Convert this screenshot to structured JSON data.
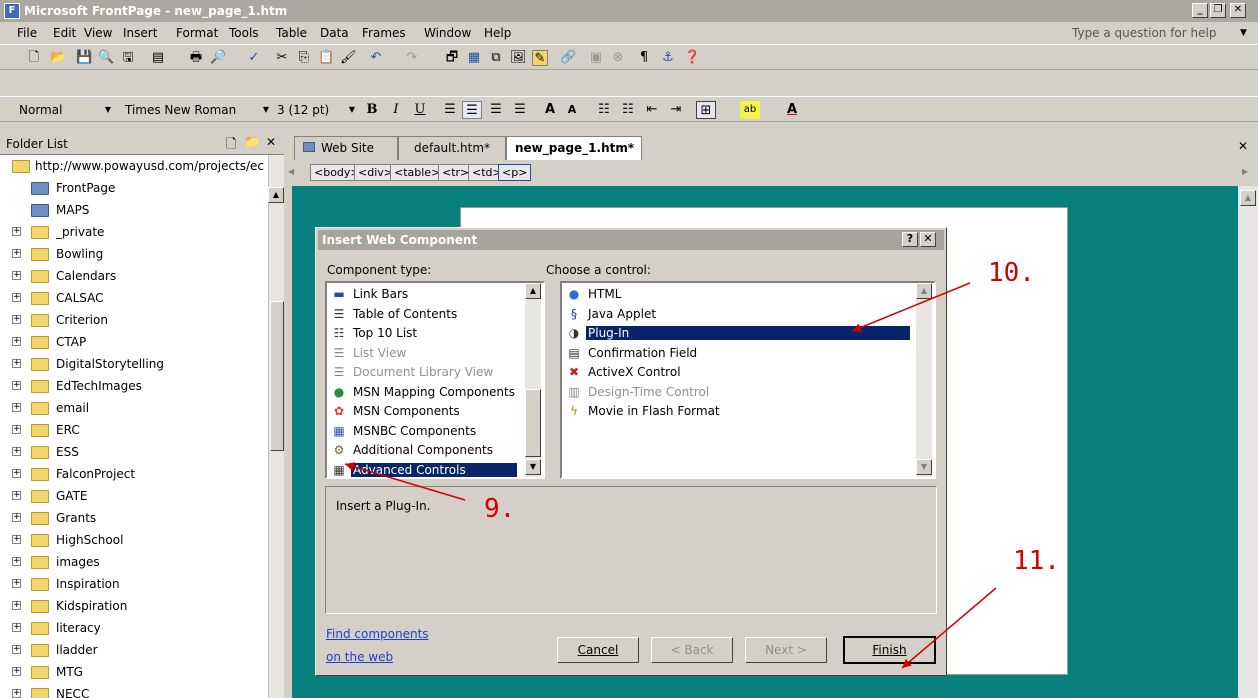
{
  "window": {
    "title": "Microsoft FrontPage - new_page_1.htm",
    "min": "_",
    "max": "❐",
    "close": "✕"
  },
  "menu": {
    "items": [
      "File",
      "Edit",
      "View",
      "Insert",
      "Format",
      "Tools",
      "Table",
      "Data",
      "Frames",
      "Window",
      "Help"
    ],
    "help_placeholder": "Type a question for help"
  },
  "format_toolbar": {
    "style": "Normal",
    "font": "Times New Roman",
    "size": "3 (12 pt)",
    "bold": "B",
    "italic": "I",
    "underline": "U"
  },
  "folder_list": {
    "title": "Folder List",
    "root": "http://www.powayusd.com/projects/ec",
    "special": [
      "FrontPage",
      "MAPS"
    ],
    "folders": [
      "_private",
      "Bowling",
      "Calendars",
      "CALSAC",
      "Criterion",
      "CTAP",
      "DigitalStorytelling",
      "EdTechImages",
      "email",
      "ERC",
      "ESS",
      "FalconProject",
      "GATE",
      "Grants",
      "HighSchool",
      "images",
      "Inspiration",
      "Kidspiration",
      "literacy",
      "lladder",
      "MTG",
      "NECC"
    ]
  },
  "tabs": [
    "Web Site",
    "default.htm*",
    "new_page_1.htm*"
  ],
  "tags": [
    "<body>",
    "<div>",
    "<table>",
    "<tr>",
    "<td>",
    "<p>"
  ],
  "dialog": {
    "title": "Insert Web Component",
    "help": "?",
    "close": "✕",
    "component_label": "Component type:",
    "control_label": "Choose a control:",
    "components": [
      {
        "label": "Link Bars",
        "icon": "link-bars-icon",
        "glyph": "▬",
        "color": "#1f4fa3"
      },
      {
        "label": "Table of Contents",
        "icon": "toc-icon",
        "glyph": "☰",
        "color": "#333"
      },
      {
        "label": "Top 10 List",
        "icon": "top10-icon",
        "glyph": "☷",
        "color": "#333"
      },
      {
        "label": "List View",
        "icon": "list-view-icon",
        "glyph": "☰",
        "color": "#888",
        "disabled": true
      },
      {
        "label": "Document Library View",
        "icon": "doc-library-icon",
        "glyph": "☰",
        "color": "#888",
        "disabled": true
      },
      {
        "label": "MSN Mapping Components",
        "icon": "globe-icon",
        "glyph": "●",
        "color": "#2a8f3a"
      },
      {
        "label": "MSN Components",
        "icon": "msn-butterfly-icon",
        "glyph": "✿",
        "color": "#e23a2a"
      },
      {
        "label": "MSNBC Components",
        "icon": "msnbc-icon",
        "glyph": "▦",
        "color": "#3050c0"
      },
      {
        "label": "Additional Components",
        "icon": "gear-icon",
        "glyph": "⚙",
        "color": "#6b6b20"
      },
      {
        "label": "Advanced Controls",
        "icon": "advanced-controls-icon",
        "glyph": "▦",
        "color": "#333",
        "selected": true
      }
    ],
    "controls": [
      {
        "label": "HTML",
        "icon": "html-globe-icon",
        "glyph": "●",
        "color": "#2b6fd0"
      },
      {
        "label": "Java Applet",
        "icon": "java-icon",
        "glyph": "§",
        "color": "#1d3a8a"
      },
      {
        "label": "Plug-In",
        "icon": "plugin-icon",
        "glyph": "◑",
        "color": "#333",
        "selected": true
      },
      {
        "label": "Confirmation Field",
        "icon": "confirmation-field-icon",
        "glyph": "▤",
        "color": "#333"
      },
      {
        "label": "ActiveX Control",
        "icon": "activex-icon",
        "glyph": "✖",
        "color": "#c81b1b"
      },
      {
        "label": "Design-Time Control",
        "icon": "design-time-icon",
        "glyph": "▥",
        "color": "#888",
        "disabled": true
      },
      {
        "label": "Movie in Flash Format",
        "icon": "flash-icon",
        "glyph": "ϟ",
        "color": "#b38a00"
      }
    ],
    "description": "Insert a Plug-In.",
    "find_link_1": "Find components",
    "find_link_2": "on the web",
    "cancel": "Cancel",
    "back": "< Back",
    "next": "Next >",
    "finish": "Finish"
  },
  "annotations": [
    "10.",
    "9.",
    "11."
  ]
}
